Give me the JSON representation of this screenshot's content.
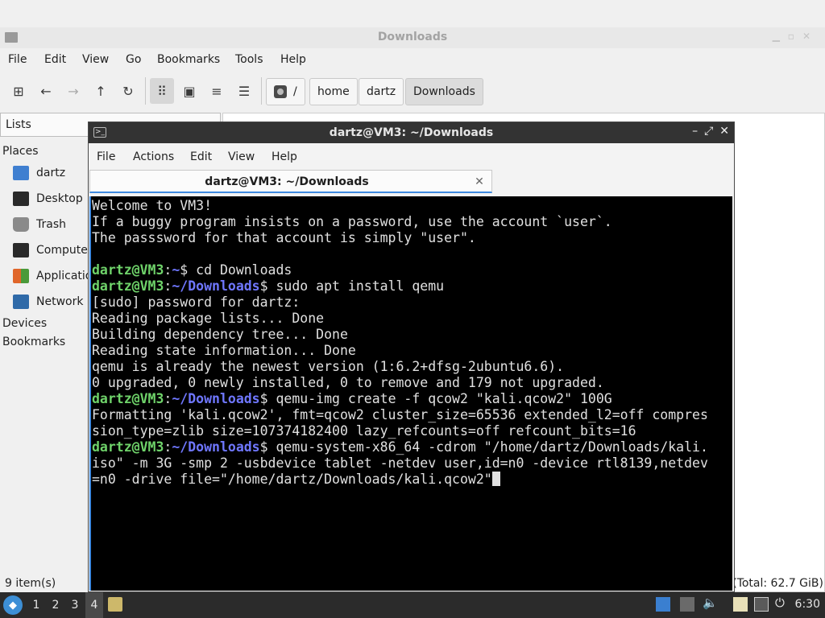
{
  "file_manager": {
    "window_title": "Downloads",
    "menu": [
      "File",
      "Edit",
      "View",
      "Go",
      "Bookmarks",
      "Tools",
      "Help"
    ],
    "path": [
      "/",
      "home",
      "dartz",
      "Downloads"
    ],
    "side_mode": "Lists",
    "sections": {
      "places": "Places",
      "devices": "Devices",
      "bookmarks": "Bookmarks"
    },
    "places": [
      {
        "label": "dartz",
        "icon": "home-folder-icon",
        "color": "#3f7fd0"
      },
      {
        "label": "Desktop",
        "icon": "desktop-icon",
        "color": "#2a2a2a"
      },
      {
        "label": "Trash",
        "icon": "trash-icon",
        "color": "#8a8a8a"
      },
      {
        "label": "Computer",
        "icon": "computer-icon",
        "color": "#2a2a2a"
      },
      {
        "label": "Applications",
        "icon": "applications-icon",
        "color": "#e0662a"
      },
      {
        "label": "Network",
        "icon": "network-icon",
        "color": "#2f6aa8"
      }
    ],
    "status_items": "9 item(s)",
    "status_total": "(Total: 62.7 GiB)"
  },
  "terminal": {
    "window_title": "dartz@VM3: ~/Downloads",
    "menu": [
      "File",
      "Actions",
      "Edit",
      "View",
      "Help"
    ],
    "tab_label": "dartz@VM3: ~/Downloads",
    "lines": [
      {
        "text": "Welcome to VM3!"
      },
      {
        "text": "If a buggy program insists on a password, use the account `user`."
      },
      {
        "text": "The passsword for that account is simply \"user\"."
      },
      {
        "text": ""
      },
      {
        "user": "dartz@VM3",
        "path": "~",
        "cmd": "$ cd Downloads"
      },
      {
        "user": "dartz@VM3",
        "path": "~/Downloads",
        "cmd": "$ sudo apt install qemu"
      },
      {
        "text": "[sudo] password for dartz:"
      },
      {
        "text": "Reading package lists... Done"
      },
      {
        "text": "Building dependency tree... Done"
      },
      {
        "text": "Reading state information... Done"
      },
      {
        "text": "qemu is already the newest version (1:6.2+dfsg-2ubuntu6.6)."
      },
      {
        "text": "0 upgraded, 0 newly installed, 0 to remove and 179 not upgraded."
      },
      {
        "user": "dartz@VM3",
        "path": "~/Downloads",
        "cmd": "$ qemu-img create -f qcow2 \"kali.qcow2\" 100G"
      },
      {
        "text": "Formatting 'kali.qcow2', fmt=qcow2 cluster_size=65536 extended_l2=off compres"
      },
      {
        "text": "sion_type=zlib size=107374182400 lazy_refcounts=off refcount_bits=16"
      },
      {
        "user": "dartz@VM3",
        "path": "~/Downloads",
        "cmd": "$ qemu-system-x86_64 -cdrom \"/home/dartz/Downloads/kali."
      },
      {
        "text": "iso\" -m 3G -smp 2 -usbdevice tablet -netdev user,id=n0 -device rtl8139,netdev"
      },
      {
        "text": "=n0 -drive file=\"/home/dartz/Downloads/kali.qcow2\"",
        "cursor": true
      }
    ]
  },
  "taskbar": {
    "workspaces": [
      "1",
      "2",
      "3",
      "4"
    ],
    "active_workspace": "4",
    "clock": "6:30"
  }
}
